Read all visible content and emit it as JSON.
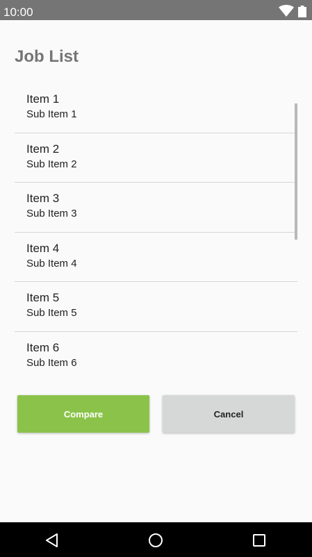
{
  "status_bar": {
    "time": "10:00",
    "icons": [
      "wifi-icon",
      "battery-icon"
    ]
  },
  "page": {
    "title": "Job List"
  },
  "job_list": {
    "items": [
      {
        "title": "Item 1",
        "subtitle": "Sub Item 1"
      },
      {
        "title": "Item 2",
        "subtitle": "Sub Item 2"
      },
      {
        "title": "Item 3",
        "subtitle": "Sub Item 3"
      },
      {
        "title": "Item 4",
        "subtitle": "Sub Item 4"
      },
      {
        "title": "Item 5",
        "subtitle": "Sub Item 5"
      },
      {
        "title": "Item 6",
        "subtitle": "Sub Item 6"
      }
    ]
  },
  "buttons": {
    "compare_label": "Compare",
    "cancel_label": "Cancel"
  },
  "nav_bar": {
    "icons": [
      "back-icon",
      "home-icon",
      "recents-icon"
    ]
  },
  "colors": {
    "status_bar": "#757575",
    "accent": "#8bc34a",
    "secondary_button": "#d6d7d7",
    "title_gray": "#757575"
  }
}
